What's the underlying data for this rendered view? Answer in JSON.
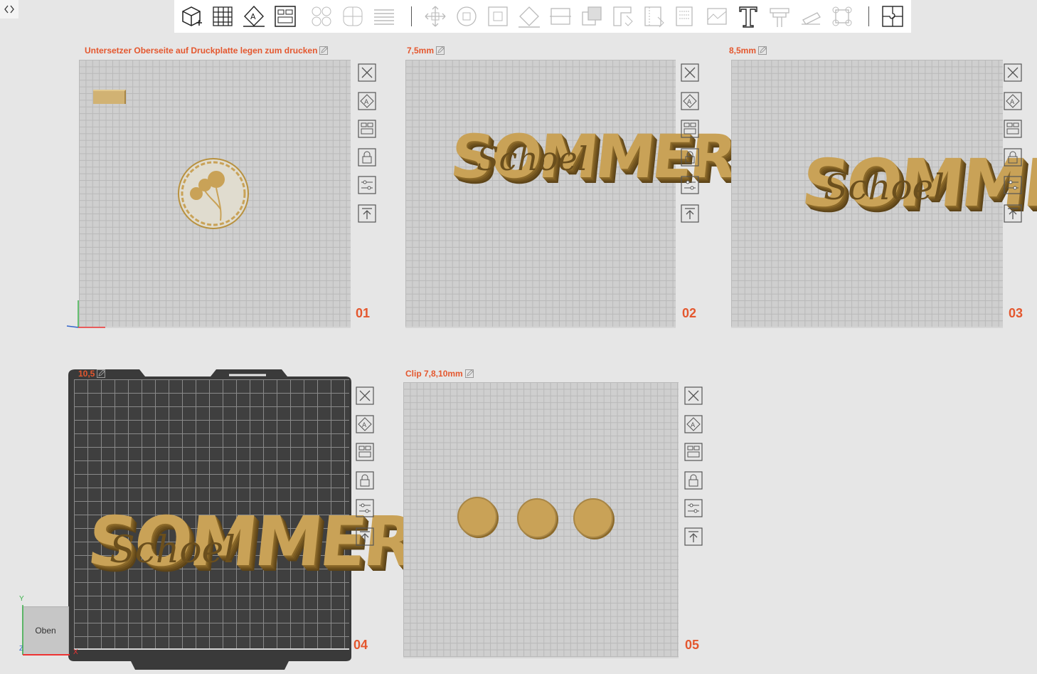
{
  "toolbar": {
    "icons": [
      "add-object-icon",
      "grid-icon",
      "auto-orient-icon",
      "arrange-icon",
      "split-objects-icon",
      "split-parts-icon",
      "layers-icon",
      "move-icon",
      "rotate-icon",
      "scale-icon",
      "lay-on-face-icon",
      "cut-icon",
      "boolean-icon",
      "support-paint-icon",
      "seam-paint-icon",
      "fuzzy-skin-icon",
      "color-paint-icon",
      "measure-icon",
      "text-icon",
      "assembly-icon",
      "emboss-icon",
      "brim-ears-icon",
      "variable-layer-icon"
    ]
  },
  "plates": [
    {
      "title": "Untersetzer Oberseite auf Druckplatte legen zum drucken",
      "number": "01"
    },
    {
      "title": "7,5mm",
      "number": "02"
    },
    {
      "title": "8,5mm",
      "number": "03"
    },
    {
      "title": "10,5",
      "number": "04"
    },
    {
      "title": "Clip 7,8,10mm",
      "number": "05"
    }
  ],
  "objects": {
    "summer_text": "SOMMER",
    "script_text": "Schoel"
  },
  "viewcube": {
    "label": "Oben",
    "x_axis": "X",
    "y_axis": "Y",
    "z_axis": "Z"
  },
  "colors": {
    "accent": "#e4572e",
    "filament": "#c9a257",
    "bed_light": "#cfcfcf",
    "bed_dark": "#3f3f3f"
  }
}
